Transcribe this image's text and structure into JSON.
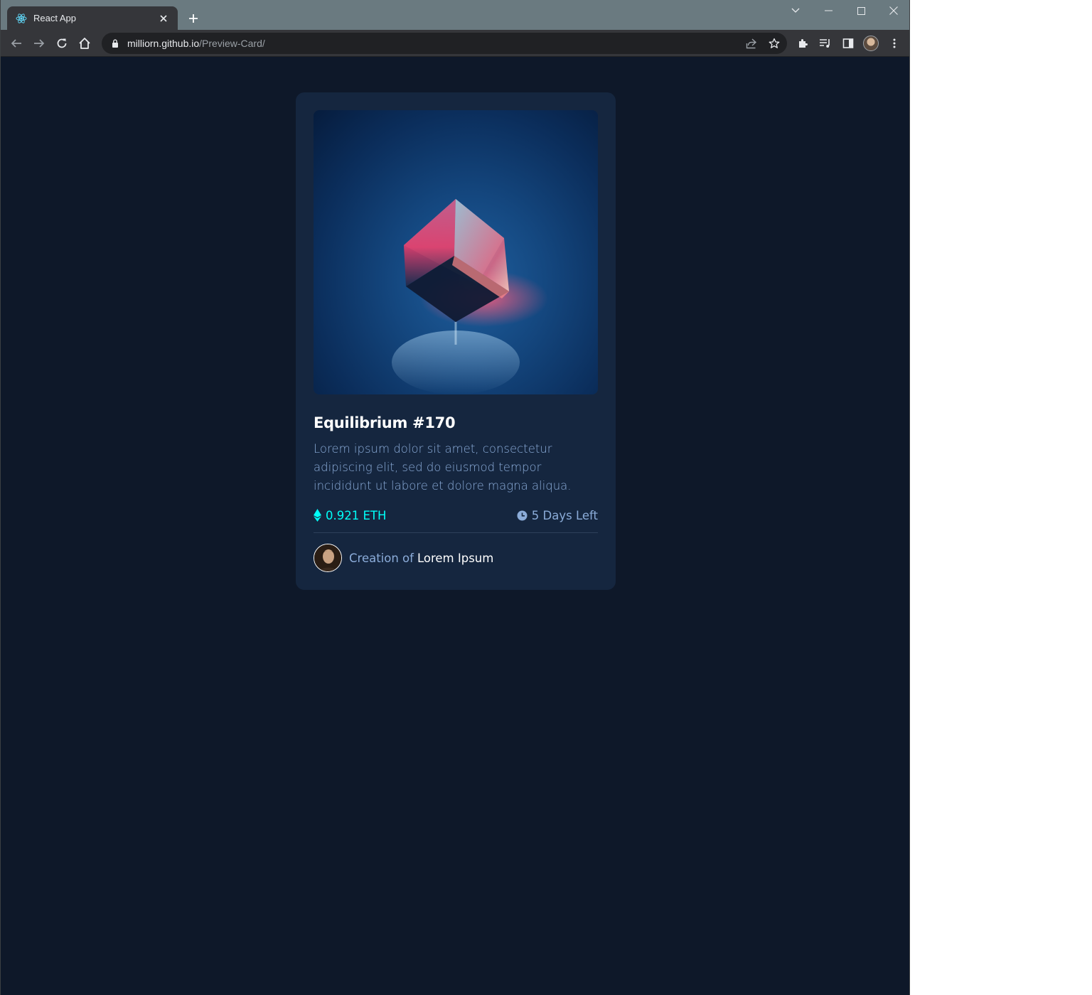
{
  "browser": {
    "tab_title": "React App",
    "url_host": "milliorn.github.io",
    "url_path": "/Preview-Card/",
    "tab_favicon": "react-logo-icon"
  },
  "card": {
    "image": "crystal-cube-image",
    "title": "Equilibrium #170",
    "description": "Lorem ipsum dolor sit amet, consectetur adipiscing elit, sed do eiusmod tempor incididunt ut labore et dolore magna aliqua.",
    "price": "0.921 ETH",
    "time_left": "5 Days Left",
    "creator_prefix": "Creation of",
    "creator_name": "Lorem Ipsum"
  },
  "colors": {
    "page_background": "#0e1829",
    "card_background": "#15263f",
    "accent_cyan": "#00fff8",
    "soft_blue": "#8bacd9",
    "white": "#ffffff"
  }
}
